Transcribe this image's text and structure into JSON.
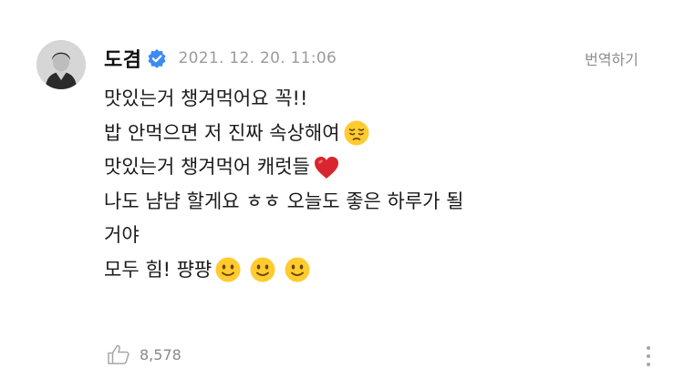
{
  "comment": {
    "author": "도겸",
    "verified": true,
    "timestamp": "2021. 12. 20. 11:06",
    "translate_label": "번역하기",
    "lines": [
      "맛있는거 챙겨먹어요 꼭!!",
      "밥 안먹으면 저 진짜 속상해여",
      "맛있는거 챙겨먹어 캐럿들",
      "나도 냠냠 할게요 ㅎㅎ 오늘도 좋은 하루가 될",
      "거야",
      "모두 힘! 퍙퍙"
    ],
    "emojis": {
      "line2": "pensive-face-emoji",
      "line3": "red-heart-emoji",
      "line6": [
        "slightly-smiling-face-emoji",
        "slightly-smiling-face-emoji",
        "slightly-smiling-face-emoji"
      ]
    },
    "likes": "8,578"
  },
  "icons": {
    "verified": "verified-badge-icon",
    "like": "thumbs-up-icon",
    "more": "more-vertical-icon"
  },
  "colors": {
    "verified_blue": "#3d8af7",
    "meta_gray": "#9b9b9b",
    "heart_red": "#d9252f",
    "emoji_yellow": "#ffcb2f"
  }
}
